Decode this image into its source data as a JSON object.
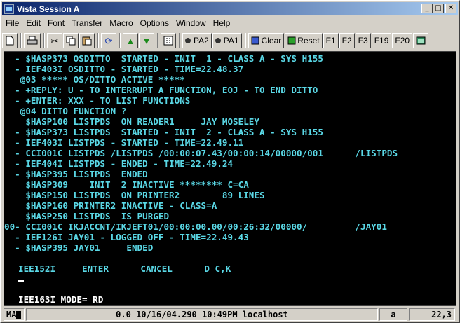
{
  "window": {
    "title": "Vista Session A",
    "minimize": "_",
    "maximize": "□",
    "close": "✕"
  },
  "menu": [
    {
      "id": "file",
      "label": "File"
    },
    {
      "id": "edit",
      "label": "Edit"
    },
    {
      "id": "font",
      "label": "Font"
    },
    {
      "id": "transfer",
      "label": "Transfer"
    },
    {
      "id": "macro",
      "label": "Macro"
    },
    {
      "id": "options",
      "label": "Options"
    },
    {
      "id": "window",
      "label": "Window"
    },
    {
      "id": "help",
      "label": "Help"
    }
  ],
  "toolbar": {
    "pa2": "PA2",
    "pa1": "PA1",
    "clear": "Clear",
    "reset": "Reset",
    "f1": "F1",
    "f2": "F2",
    "f3": "F3",
    "f19": "F19",
    "f20": "F20"
  },
  "terminal": {
    "lines": [
      "  - $HASP373 OSDITTO  STARTED - INIT  1 - CLASS A - SYS H155",
      "  - IEF403I OSDITTO - STARTED - TIME=22.48.37",
      "   @03 ***** OS/DITTO ACTIVE *****",
      "  - +REPLY: U - TO INTERRUPT A FUNCTION, EOJ - TO END DITTO",
      "  - +ENTER: XXX - TO LIST FUNCTIONS",
      "   @04 DITTO FUNCTION ?",
      "    $HASP100 LISTPDS  ON READER1     JAY MOSELEY",
      "  - $HASP373 LISTPDS  STARTED - INIT  2 - CLASS A - SYS H155",
      "  - IEF403I LISTPDS - STARTED - TIME=22.49.11",
      "  - CCI001C LISTPDS /LISTPDS /00:00:07.43/00:00:14/00000/001      /LISTPDS",
      "  - IEF404I LISTPDS - ENDED - TIME=22.49.24",
      "  - $HASP395 LISTPDS  ENDED",
      "    $HASP309    INIT  2 INACTIVE ******** C=CA",
      "    $HASP150 LISTPDS  ON PRINTER2        89 LINES",
      "    $HASP160 PRINTER2 INACTIVE - CLASS=A",
      "    $HASP250 LISTPDS  IS PURGED",
      "00- CCI001C IKJACCNT/IKJEFT01/00:00:00.00/00:26:32/00000/         /JAY01",
      "  - IEF126I JAY01 - LOGGED OFF - TIME=22.49.43",
      "  - $HASP395 JAY01     ENDED",
      "",
      "IEE152I     ENTER      CANCEL      D C,K"
    ],
    "mode_line": "IEE163I MODE= RD"
  },
  "status": {
    "left": "MA",
    "info": "0.0 10/16/04.290 10:49PM localhost",
    "mode": "a",
    "position": "22,3"
  }
}
